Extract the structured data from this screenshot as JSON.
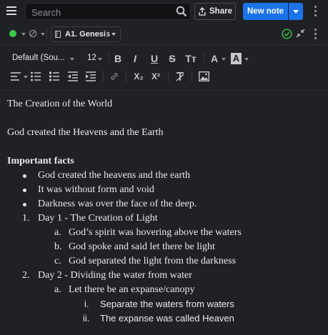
{
  "header": {
    "search_placeholder": "Search",
    "share_label": "Share",
    "new_note_label": "New note"
  },
  "note_bar": {
    "status_color": "#3ec84a",
    "notebook_label": "A1. Genesis"
  },
  "toolbar": {
    "font_family": "Default (Sou...",
    "font_size": "12",
    "bold": "B",
    "italic": "I",
    "underline": "U",
    "strike": "S",
    "text_size": "Tт",
    "font_color": "A",
    "highlight": "A",
    "subscript": "X₂",
    "superscript": "X²",
    "clear_format": "T̸"
  },
  "editor": {
    "title": "The Creation of the World",
    "subtitle": "God created the Heavens and the Earth",
    "heading": "Important facts",
    "bullets": [
      "God created the heavens and the earth",
      "It was without form and void",
      "Darkness was over the face of the deep."
    ],
    "days": [
      {
        "marker": "1.",
        "label": "Day 1 - The Creation of Light",
        "items": [
          {
            "marker": "a.",
            "text": "God’s spirit was hovering above the waters"
          },
          {
            "marker": "b.",
            "text": "God spoke and said let there be light"
          },
          {
            "marker": "c.",
            "text": "God separated the light from the darkness"
          }
        ]
      },
      {
        "marker": "2.",
        "label": "Day 2 - Dividing the water from water",
        "items": [
          {
            "marker": "a.",
            "text": "Let there be an expanse/canopy"
          }
        ],
        "subitems": [
          {
            "marker": "i.",
            "text": "Separate the waters from waters"
          },
          {
            "marker": "ii.",
            "text": "The expanse was called Heaven"
          }
        ]
      }
    ]
  },
  "colors": {
    "accent": "#1a73e8",
    "background": "#202124",
    "sync_check": "#3ec84a"
  }
}
